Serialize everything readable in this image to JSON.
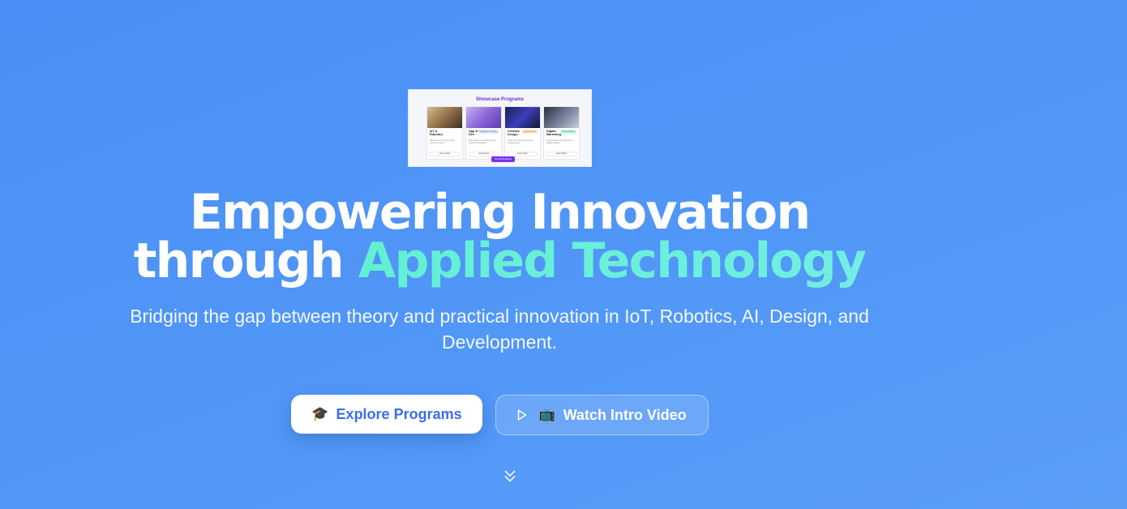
{
  "preview": {
    "title": "Showcase Programs",
    "cards": [
      {
        "title": "IoT & Robotics",
        "badge": "",
        "desc": "Hands-on IoT, sensors and robotics projects.",
        "button": "Learn More"
      },
      {
        "title": "App & Web Dev",
        "badge": "Beginner Friendly",
        "desc": "Build apps and websites using modern frameworks.",
        "button": "Learn More"
      },
      {
        "title": "Creative Design",
        "badge": "Most Popular",
        "desc": "UI/UX, 3D and visual design fundamentals.",
        "button": "Learn More"
      },
      {
        "title": "Digital Marketing",
        "badge": "Career Ready",
        "desc": "Grow brands with data-driven digital strategy.",
        "button": "Learn More"
      }
    ],
    "view_all": "View All Programs"
  },
  "hero": {
    "headline_line1": "Empowering Innovation",
    "headline_line2_start": "through ",
    "headline_line2_accent": "Applied Technology",
    "subtitle": "Bridging the gap between theory and practical innovation in IoT, Robotics, AI, Design, and Development."
  },
  "buttons": {
    "primary_icon": "🎓",
    "primary_label": "Explore Programs",
    "secondary_icon": "📺",
    "secondary_label": "Watch Intro Video"
  },
  "icons": {
    "play": "play-icon",
    "scroll": "chevrons-down-icon",
    "graduation": "graduation-cap-icon",
    "tv": "tv-icon"
  },
  "colors": {
    "background": "#4a8ef5",
    "accent": "#62f0d2",
    "primary_text": "#3c6fe6",
    "preview_accent": "#7b2ff0"
  }
}
